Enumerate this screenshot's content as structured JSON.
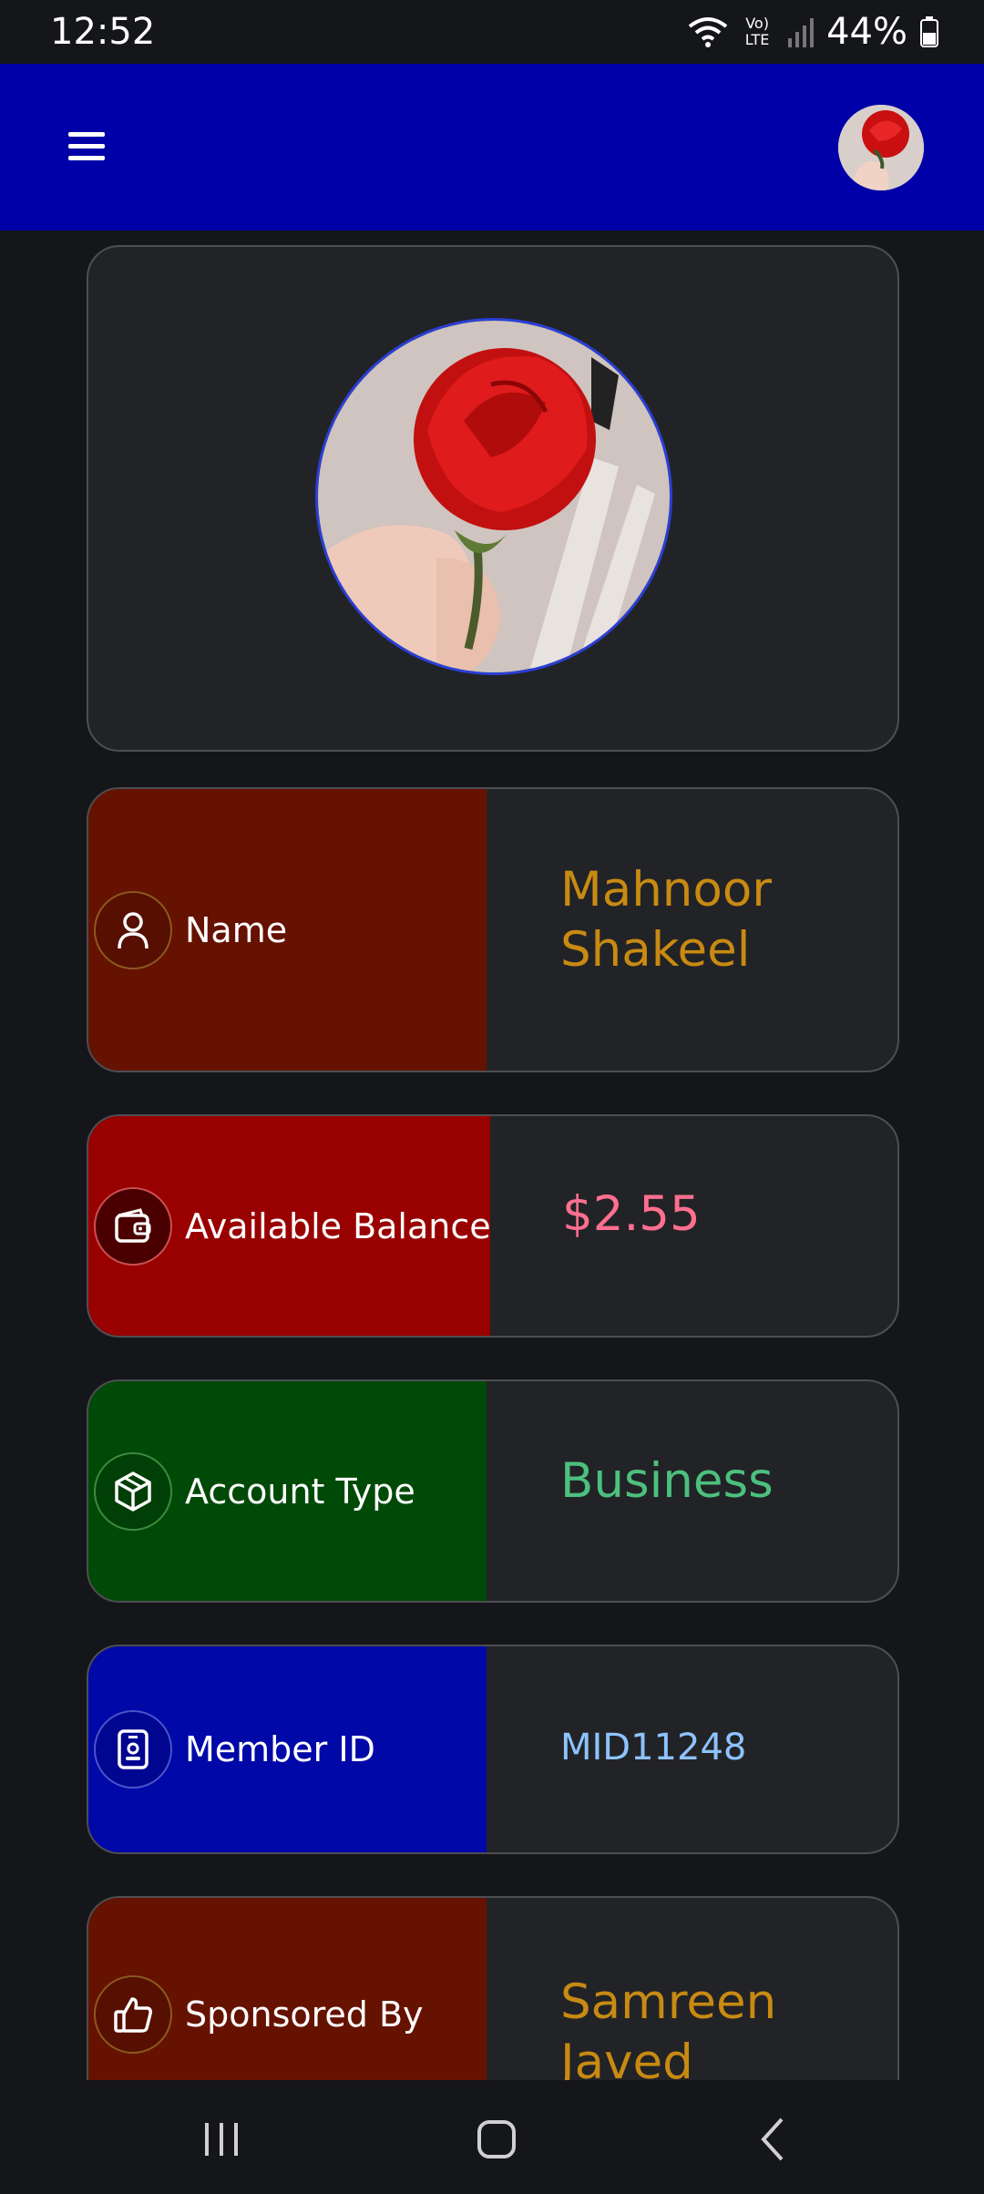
{
  "status_bar": {
    "time": "12:52",
    "network_label": "Vo) LTE",
    "battery": "44%"
  },
  "header": {
    "menu_icon": "hamburger-menu-icon",
    "avatar_icon": "profile-avatar"
  },
  "colors": {
    "app_bar": "#0000a8",
    "background": "#15161a",
    "card": "#222326",
    "name_panel": "#661200",
    "balance_panel": "#990000",
    "account_panel": "#004a08",
    "member_panel": "#0008a8",
    "sponsor_panel": "#661200"
  },
  "info_cards": [
    {
      "icon": "user-icon",
      "label": "Name",
      "value": "Mahnoor\nShakeel",
      "value_color": "#c88a12"
    },
    {
      "icon": "wallet-icon",
      "label": "Available Balance",
      "value": "$2.55",
      "value_color": "#ff6f8f"
    },
    {
      "icon": "cube-icon",
      "label": "Account Type",
      "value": "Business",
      "value_color": "#4cc07e"
    },
    {
      "icon": "id-badge-icon",
      "label": "Member ID",
      "value": "MID11248",
      "value_color": "#8ec3ff"
    },
    {
      "icon": "thumbs-up-icon",
      "label": "Sponsored By",
      "value": "Samreen\nJaved",
      "value_color": "#c88a12"
    }
  ],
  "nav": {
    "recents_icon": "recents-icon",
    "home_icon": "home-icon",
    "back_icon": "back-icon"
  }
}
